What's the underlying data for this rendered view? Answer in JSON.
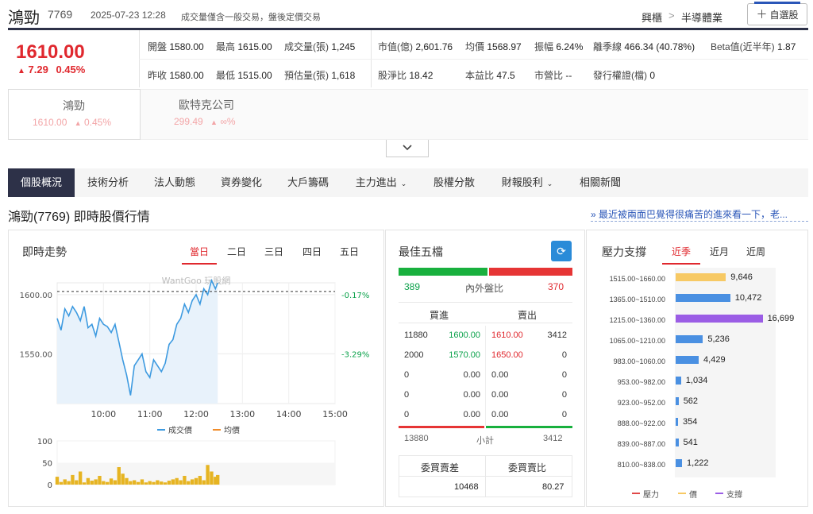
{
  "header": {
    "name": "鴻勁",
    "code": "7769",
    "datetime": "2025-07-23 12:28",
    "note": "成交量僅含一般交易，盤後定價交易",
    "market": "興櫃",
    "separator": ">",
    "industry": "半導體業",
    "watch_label": "自選股"
  },
  "quote": {
    "price": "1610.00",
    "change": "7.29",
    "change_pct": "0.45%",
    "row1": [
      {
        "label": "開盤",
        "value": "1580.00"
      },
      {
        "label": "最高",
        "value": "1615.00"
      },
      {
        "label": "成交量(張)",
        "value": "1,245"
      },
      {
        "label": "市值(億)",
        "value": "2,601.76"
      },
      {
        "label": "均價",
        "value": "1568.97"
      },
      {
        "label": "振幅",
        "value": "6.24%"
      },
      {
        "label": "離季線",
        "value": "466.34 (40.78%)"
      },
      {
        "label": "Beta值(近半年)",
        "value": "1.87"
      }
    ],
    "row2": [
      {
        "label": "昨收",
        "value": "1580.00"
      },
      {
        "label": "最低",
        "value": "1515.00"
      },
      {
        "label": "預估量(張)",
        "value": "1,618"
      },
      {
        "label": "股淨比",
        "value": "18.42"
      },
      {
        "label": "本益比",
        "value": "47.5"
      },
      {
        "label": "市營比",
        "value": "--"
      },
      {
        "label": "發行權證(檔)",
        "value": "0"
      }
    ]
  },
  "related": [
    {
      "name": "鴻勁",
      "price": "1610.00",
      "arrow": "▲",
      "chg": "0.45%"
    },
    {
      "name": "歐特克公司",
      "price": "299.49",
      "arrow": "▲",
      "chg": "∞%"
    }
  ],
  "tabs": [
    "個股概況",
    "技術分析",
    "法人動態",
    "資券變化",
    "大戶籌碼",
    "主力進出",
    "股權分散",
    "財報股利",
    "相關新聞"
  ],
  "page_title": "鴻勁(7769) 即時股價行情",
  "news_link": "» 最近被兩面巴覺得很痛苦的進來看一下，老...",
  "trend": {
    "title": "即時走勢",
    "range_tabs": [
      "當日",
      "二日",
      "三日",
      "四日",
      "五日"
    ],
    "watermark": "WantGoo 玩股網",
    "legend_price": "成交價",
    "legend_avg": "均價",
    "vol_ticks": [
      "100",
      "50",
      "0"
    ]
  },
  "best5": {
    "title": "最佳五檔",
    "buy_ratio": 0.51,
    "inner": "389",
    "ratio_label": "內外盤比",
    "outer": "370",
    "col_buy": "買進",
    "col_sell": "賣出",
    "rows": [
      {
        "bq": "11880",
        "bp": "1600.00",
        "sp": "1610.00",
        "sq": "3412"
      },
      {
        "bq": "2000",
        "bp": "1570.00",
        "sp": "1650.00",
        "sq": "0"
      },
      {
        "bq": "0",
        "bp": "0.00",
        "sp": "0.00",
        "sq": "0"
      },
      {
        "bq": "0",
        "bp": "0.00",
        "sp": "0.00",
        "sq": "0"
      },
      {
        "bq": "0",
        "bp": "0.00",
        "sp": "0.00",
        "sq": "0"
      }
    ],
    "total_buy": "13880",
    "total_label": "小計",
    "total_sell": "3412",
    "diff_label": "委買賣差",
    "ratio2_label": "委買賣比",
    "diff_value": "10468",
    "ratio2_value": "80.27"
  },
  "support": {
    "title": "壓力支撐",
    "tabs": [
      "近季",
      "近月",
      "近周"
    ],
    "legend": [
      "壓力",
      "價",
      "支撐"
    ]
  },
  "chart_data": [
    {
      "type": "line",
      "title": "即時走勢",
      "x_ticks": [
        "10:00",
        "11:00",
        "12:00",
        "13:00",
        "14:00",
        "15:00"
      ],
      "y_ticks": [
        "1600.00",
        "1550.00"
      ],
      "right_ticks": [
        "-0.17%",
        "-3.29%"
      ],
      "ylim": [
        1508,
        1610
      ],
      "reference": 1602.71,
      "series": [
        {
          "name": "成交價",
          "x": [
            "09:00",
            "09:05",
            "09:10",
            "09:15",
            "09:20",
            "09:25",
            "09:30",
            "09:35",
            "09:40",
            "09:45",
            "09:50",
            "09:55",
            "10:00",
            "10:05",
            "10:10",
            "10:15",
            "10:20",
            "10:25",
            "10:30",
            "10:35",
            "10:40",
            "10:45",
            "10:50",
            "10:55",
            "11:00",
            "11:05",
            "11:10",
            "11:15",
            "11:20",
            "11:25",
            "11:30",
            "11:35",
            "11:40",
            "11:45",
            "11:50",
            "11:55",
            "12:00",
            "12:05",
            "12:10",
            "12:15",
            "12:20",
            "12:25",
            "12:28"
          ],
          "values": [
            1580,
            1570,
            1588,
            1582,
            1590,
            1585,
            1578,
            1590,
            1572,
            1575,
            1565,
            1580,
            1575,
            1573,
            1568,
            1575,
            1560,
            1545,
            1532,
            1515,
            1540,
            1545,
            1550,
            1535,
            1530,
            1545,
            1540,
            1535,
            1542,
            1558,
            1562,
            1575,
            1580,
            1592,
            1585,
            1595,
            1600,
            1592,
            1605,
            1600,
            1612,
            1605,
            1610
          ]
        }
      ],
      "volume": {
        "ylim": [
          0,
          100
        ],
        "values": [
          18,
          6,
          12,
          8,
          22,
          10,
          30,
          5,
          15,
          9,
          12,
          20,
          8,
          6,
          14,
          10,
          40,
          25,
          15,
          8,
          10,
          6,
          12,
          5,
          8,
          6,
          10,
          7,
          5,
          9,
          12,
          15,
          10,
          20,
          8,
          12,
          15,
          20,
          10,
          45,
          30,
          18,
          22
        ]
      }
    },
    {
      "type": "bar",
      "title": "壓力支撐",
      "categories": [
        "1515.00~1660.00",
        "1365.00~1510.00",
        "1215.00~1360.00",
        "1065.00~1210.00",
        "983.00~1060.00",
        "953.00~982.00",
        "923.00~952.00",
        "888.00~922.00",
        "839.00~887.00",
        "810.00~838.00"
      ],
      "values": [
        9646,
        10472,
        16699,
        5236,
        4429,
        1034,
        562,
        354,
        541,
        1222
      ],
      "value_labels": [
        "9,646",
        "10,472",
        "16,699",
        "5,236",
        "4,429",
        "1,034",
        "562",
        "354",
        "541",
        "1,222"
      ],
      "kinds": [
        "price",
        "support",
        "support_strong",
        "support",
        "support",
        "support",
        "support",
        "support",
        "support",
        "support"
      ],
      "colors": {
        "price": "#f7c964",
        "support": "#4a90e2",
        "support_strong": "#9b5de5",
        "pressure": "#e04848"
      },
      "xlim": [
        0,
        18000
      ]
    }
  ]
}
